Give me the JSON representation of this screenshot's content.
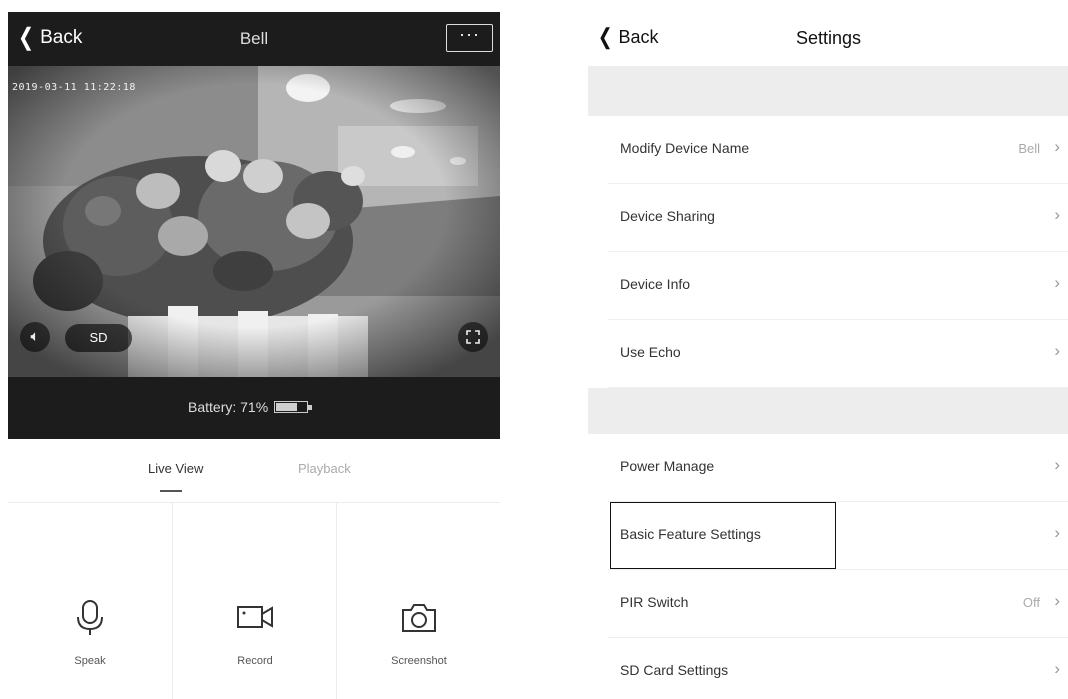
{
  "left": {
    "header": {
      "back_label": "Back",
      "title": "Bell",
      "more_label": "···"
    },
    "video": {
      "timestamp": "2019-03-11 11:22:18",
      "quality_label": "SD"
    },
    "battery": {
      "text": "Battery: 71%",
      "level": 0.71
    },
    "tabs": [
      {
        "label": "Live View",
        "active": true
      },
      {
        "label": "Playback",
        "active": false
      }
    ],
    "actions": [
      {
        "label": "Speak",
        "icon": "microphone-icon"
      },
      {
        "label": "Record",
        "icon": "video-camera-icon"
      },
      {
        "label": "Screenshot",
        "icon": "camera-icon"
      }
    ]
  },
  "right": {
    "header": {
      "back_label": "Back",
      "title": "Settings"
    },
    "rows": [
      {
        "label": "Modify Device Name",
        "value": "Bell"
      },
      {
        "label": "Device Sharing",
        "value": ""
      },
      {
        "label": "Device Info",
        "value": ""
      },
      {
        "label": "Use Echo",
        "value": ""
      },
      {
        "label": "Power Manage",
        "value": ""
      },
      {
        "label": "Basic Feature Settings",
        "value": "",
        "highlighted": true
      },
      {
        "label": "PIR Switch",
        "value": "Off"
      },
      {
        "label": "SD Card Settings",
        "value": ""
      }
    ],
    "chevron": "›"
  }
}
